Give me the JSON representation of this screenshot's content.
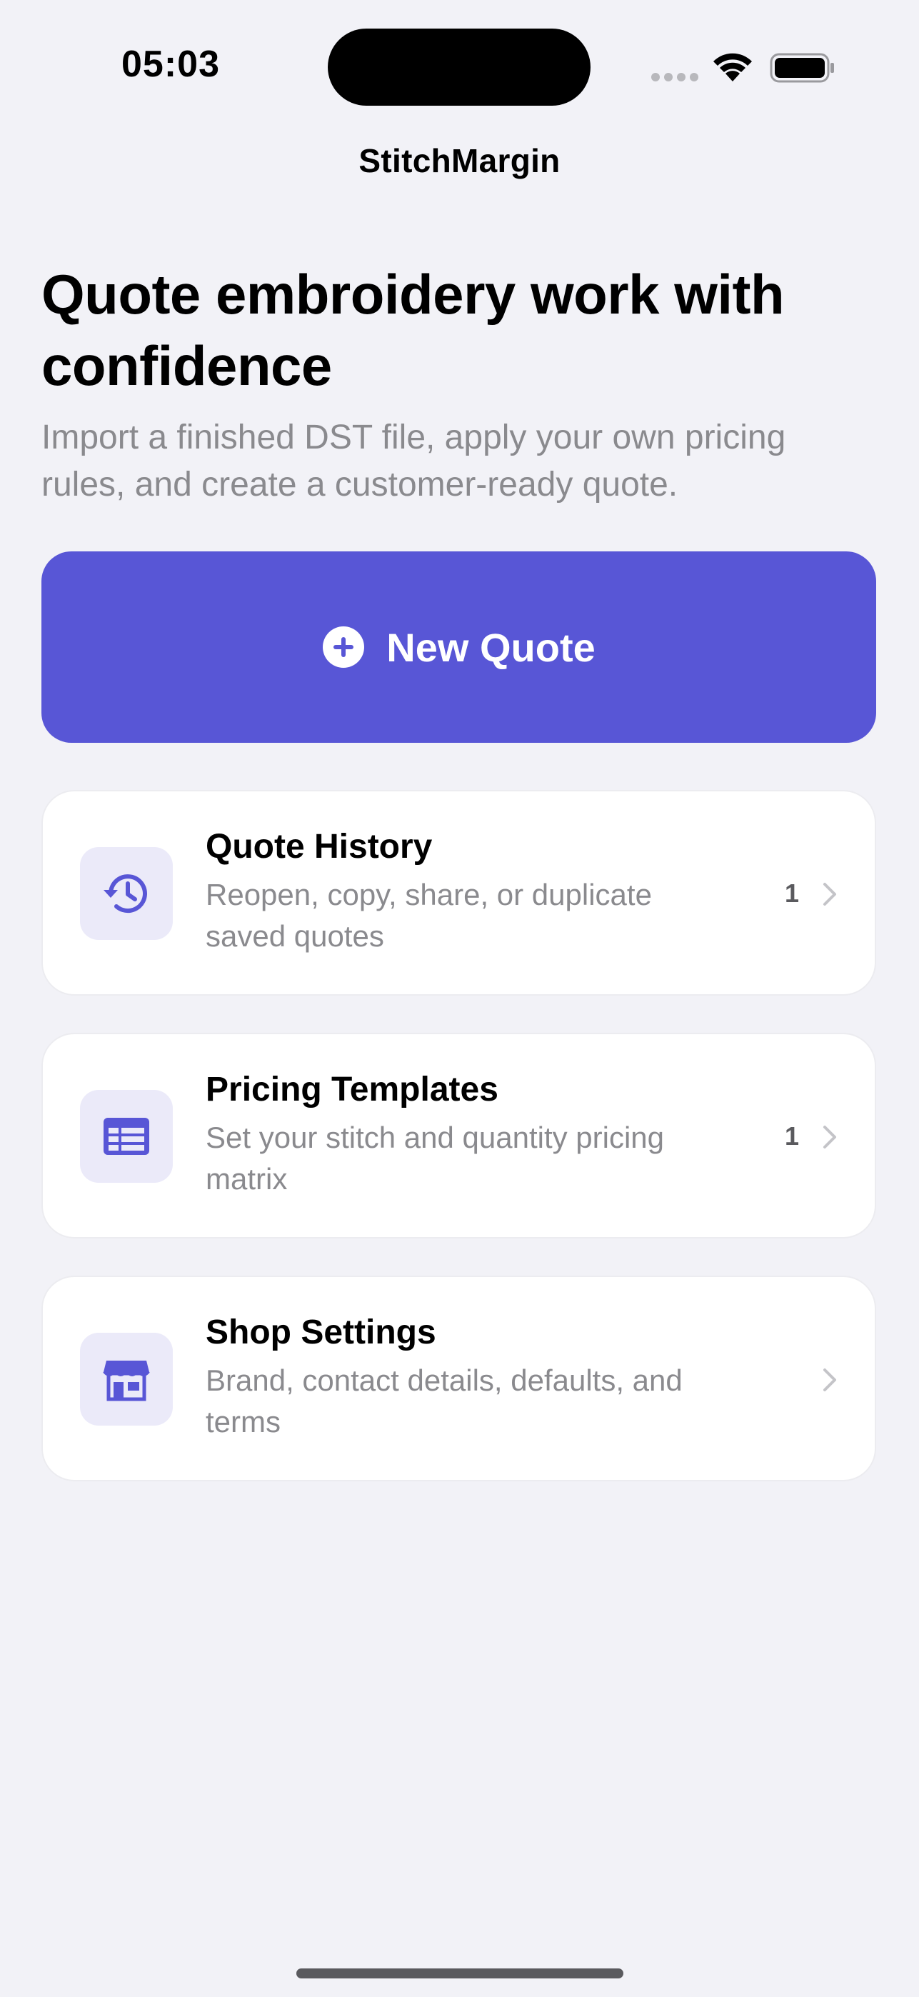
{
  "status_bar": {
    "time": "05:03",
    "icons": [
      "signal-icon",
      "wifi-icon",
      "battery-icon"
    ]
  },
  "nav": {
    "title": "StitchMargin"
  },
  "hero": {
    "title": "Quote embroidery work with confidence",
    "subtitle": "Import a finished DST file, apply your own pricing rules, and create a customer-ready quote."
  },
  "primary_action": {
    "label": "New Quote",
    "icon": "plus-circle-icon",
    "color": "#5856D6"
  },
  "menu": [
    {
      "title": "Quote History",
      "description": "Reopen, copy, share, or duplicate saved quotes",
      "count": "1",
      "icon": "history-icon"
    },
    {
      "title": "Pricing Templates",
      "description": "Set your stitch and quantity pricing matrix",
      "count": "1",
      "icon": "table-icon"
    },
    {
      "title": "Shop Settings",
      "description": "Brand, contact details, defaults, and terms",
      "count": "",
      "icon": "storefront-icon"
    }
  ],
  "colors": {
    "accent": "#5856D6",
    "background": "#F2F2F7",
    "secondary_text": "#8A8A8E",
    "icon_tile": "#EBEAF9"
  }
}
